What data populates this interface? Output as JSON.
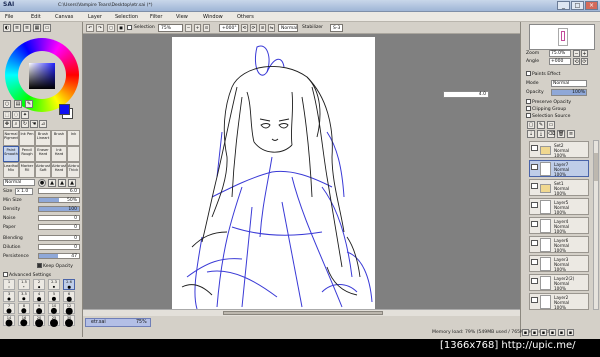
{
  "titlebar": {
    "app": "SAI",
    "path": "C:\\Users\\Vampire Tears\\Desktop\\etr.sai (*)",
    "minimize": "_",
    "maximize": "□",
    "close": "×"
  },
  "menu": [
    "File",
    "Edit",
    "Canvas",
    "Layer",
    "Selection",
    "Filter",
    "View",
    "Window",
    "Others"
  ],
  "toolbar": {
    "selection_label": "Selection",
    "zoom": "75%",
    "rotation": "+000°",
    "blend": "Normal",
    "stabilizer_label": "Stabilizer",
    "stabilizer_value": "S-3"
  },
  "left": {
    "tools_row1": [
      "Normal Pigment",
      "Ink Pen",
      "Brush Lineart",
      "Brush",
      "Ink"
    ],
    "tools_row2": [
      "Paint Smooth",
      "Pencil Rough",
      "Eraser Hard",
      "Ink Hard",
      ""
    ],
    "tools_row3": [
      "Leadhold Mix",
      "Marker Fill",
      "Airbrush Soft",
      "Airbrush Hard",
      "Airbrush Thick"
    ],
    "blend_mode": "Normal",
    "size_label": "Size",
    "size_mult": "x 1.0",
    "size_value": "6.0",
    "minsize_label": "Min Size",
    "minsize_value": "50%",
    "minsize_pct": 0.5,
    "density_label": "Density",
    "density_value": "100",
    "density_pct": 1.0,
    "noise_label": "Noise",
    "noise_value": "0",
    "paper_label": "Paper",
    "paper_value": "0",
    "blending_label": "Blending",
    "blending_value": "0",
    "dilution_label": "Dilution",
    "dilution_value": "0",
    "persistence_label": "Persistence",
    "persistence_value": "47",
    "persistence_pct": 0.47,
    "keep_opacity": "Keep Opacity",
    "advanced": "Advanced Settings",
    "brush_sizes": [
      "1",
      "1.5",
      "2",
      "2.3",
      "2.6",
      "3",
      "3.5",
      "4",
      "5",
      "6",
      "7",
      "8",
      "9",
      "10",
      "12",
      "14",
      "16",
      "20",
      "25",
      "30"
    ]
  },
  "right": {
    "zoom_label": "Zoom",
    "zoom_value": "75.0%",
    "angle_label": "Angle",
    "angle_value": "+000",
    "paint_effect": "Paints Effect",
    "mode_label": "Mode",
    "mode_value": "Normal",
    "opacity_label": "Opacity",
    "opacity_value": "100%",
    "preserve_opacity": "Preserve Opacity",
    "clipping_group": "Clipping Group",
    "selection_source": "Selection Source",
    "layers": [
      {
        "name": "Set2",
        "mode": "Normal",
        "opacity": "100%",
        "selected": false,
        "folder": true
      },
      {
        "name": "Layer7",
        "mode": "Normal",
        "opacity": "100%",
        "selected": true,
        "folder": false
      },
      {
        "name": "Set1",
        "mode": "Normal",
        "opacity": "100%",
        "selected": false,
        "folder": true
      },
      {
        "name": "Layer5",
        "mode": "Normal",
        "opacity": "100%",
        "selected": false,
        "folder": false
      },
      {
        "name": "Layer4",
        "mode": "Normal",
        "opacity": "100%",
        "selected": false,
        "folder": false
      },
      {
        "name": "Layer6",
        "mode": "Normal",
        "opacity": "100%",
        "selected": false,
        "folder": false
      },
      {
        "name": "Layer3",
        "mode": "Normal",
        "opacity": "100%",
        "selected": false,
        "folder": false
      },
      {
        "name": "Layer2(2)",
        "mode": "Normal",
        "opacity": "100%",
        "selected": false,
        "folder": false
      },
      {
        "name": "Layer2",
        "mode": "Normal",
        "opacity": "100%",
        "selected": false,
        "folder": false
      }
    ]
  },
  "canvas": {
    "external_field": "4.0"
  },
  "file_tab": {
    "name": "etr.sai",
    "zoom": "75%"
  },
  "status": {
    "memory": "Memory load: 79% (549MB used / 765MB reserved)"
  },
  "watermark": "[1366x768] http://upic.me/",
  "colors": {
    "primary": "#1010f0",
    "secondary": "#ffffff",
    "selection": "#bfcde8",
    "lineart": "#1e1e1e",
    "sketch": "#3a3ad6"
  },
  "icons": [
    "paint-bucket-icon",
    "eraser-icon",
    "selection-icon",
    "lasso-icon",
    "magic-wand-icon",
    "zoom-icon",
    "move-icon",
    "hand-icon",
    "eye-icon",
    "folder-icon"
  ]
}
